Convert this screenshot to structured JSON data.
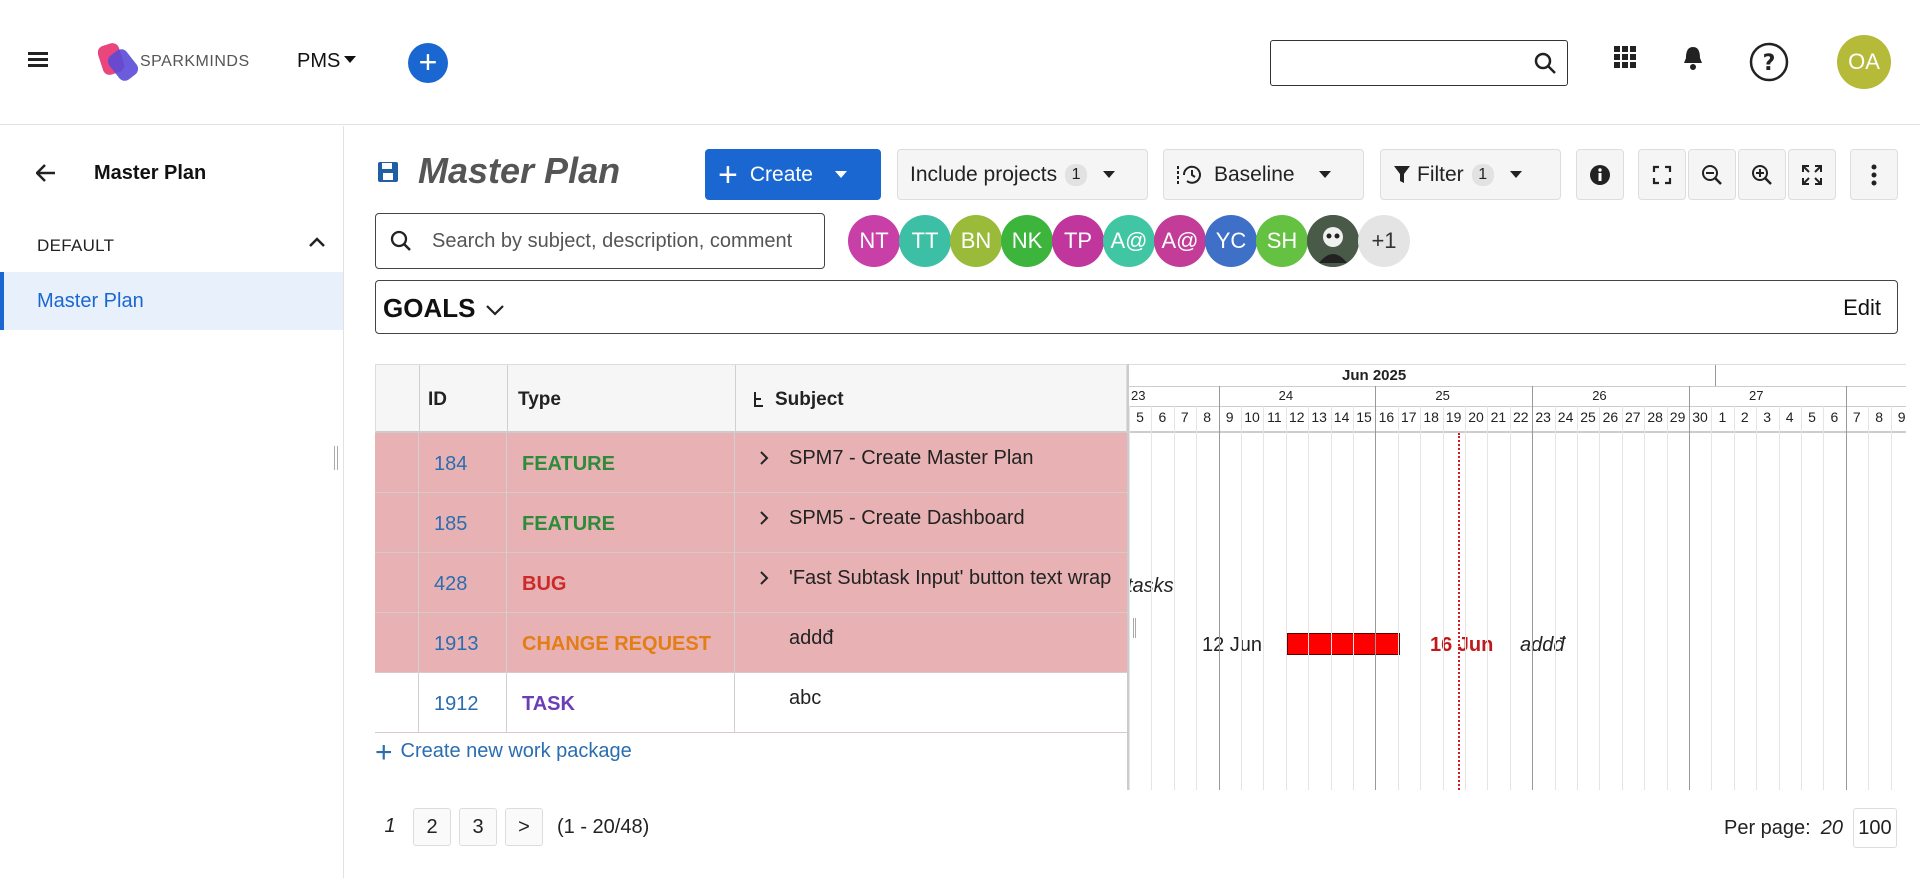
{
  "header": {
    "logo_text": "SPARKMINDS",
    "project_switch": "PMS",
    "search_value": "",
    "user_initials": "OA",
    "user_color": "#b5bb38"
  },
  "sidebar": {
    "title": "Master Plan",
    "group": "DEFAULT",
    "items": [
      {
        "label": "Master Plan",
        "active": true
      }
    ]
  },
  "toolbar": {
    "title": "Master Plan",
    "create_label": "Create",
    "include_projects_label": "Include projects",
    "include_projects_count": "1",
    "baseline_label": "Baseline",
    "filter_label": "Filter",
    "filter_count": "1"
  },
  "search": {
    "placeholder": "Search by subject, description, comment"
  },
  "members": [
    {
      "initials": "NT",
      "color": "#c93fa8"
    },
    {
      "initials": "TT",
      "color": "#3dbfa6"
    },
    {
      "initials": "BN",
      "color": "#9aba3a"
    },
    {
      "initials": "NK",
      "color": "#3db53d"
    },
    {
      "initials": "TP",
      "color": "#c0369c"
    },
    {
      "initials": "A@",
      "color": "#41c6a3"
    },
    {
      "initials": "A@",
      "color": "#c23c98"
    },
    {
      "initials": "YC",
      "color": "#3d70c6"
    },
    {
      "initials": "SH",
      "color": "#65c141"
    },
    {
      "initials": "",
      "color": "#556655"
    },
    {
      "initials": "+1",
      "color": "#e4e4e4"
    }
  ],
  "goals": {
    "label": "GOALS",
    "edit_label": "Edit"
  },
  "table": {
    "headers": {
      "id": "ID",
      "type": "Type",
      "subject": "Subject"
    },
    "rows": [
      {
        "id": "184",
        "type": "FEATURE",
        "type_color": "#2e8b3a",
        "subject": "SPM7 - Create Master Plan",
        "expandable": true,
        "highlight": true
      },
      {
        "id": "185",
        "type": "FEATURE",
        "type_color": "#2e8b3a",
        "subject": "SPM5 - Create Dashboard",
        "expandable": true,
        "highlight": true
      },
      {
        "id": "428",
        "type": "BUG",
        "type_color": "#cc2929",
        "subject": "'Fast Subtask Input' button text wrap",
        "expandable": true,
        "highlight": true
      },
      {
        "id": "1913",
        "type": "CHANGE REQUEST",
        "type_color": "#e37d16",
        "subject": "addđ",
        "expandable": false,
        "highlight": true
      },
      {
        "id": "1912",
        "type": "TASK",
        "type_color": "#6a3fb5",
        "subject": "abc",
        "expandable": false,
        "highlight": false
      }
    ],
    "create_label": "Create new work package"
  },
  "gantt": {
    "months": [
      "Jun 2025"
    ],
    "weeks": [
      "23",
      "24",
      "25",
      "26",
      "27"
    ],
    "days": [
      "5",
      "6",
      "7",
      "8",
      "9",
      "10",
      "11",
      "12",
      "13",
      "14",
      "15",
      "16",
      "17",
      "18",
      "19",
      "20",
      "21",
      "22",
      "23",
      "24",
      "25",
      "26",
      "27",
      "28",
      "29",
      "30",
      "1",
      "2",
      "3",
      "4",
      "5",
      "6",
      "7",
      "8",
      "9"
    ],
    "label_428": "tasks",
    "bar_1913": {
      "start_label": "12 Jun",
      "end_label": "16 Jun",
      "subject": "addđ",
      "color": "#ff0000"
    }
  },
  "pagination": {
    "current": "1",
    "pages": [
      "2",
      "3"
    ],
    "next": ">",
    "range": "(1 - 20/48)",
    "per_page_label": "Per page:",
    "per_page_current": "20",
    "per_page_alt": "100"
  }
}
